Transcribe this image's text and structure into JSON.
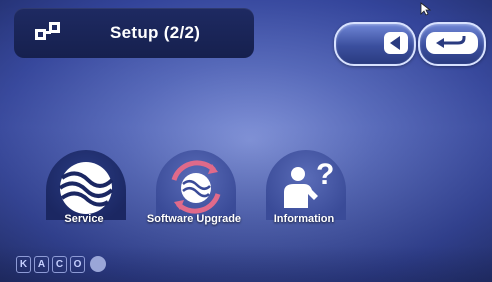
{
  "header": {
    "title": "Setup (2/2)"
  },
  "menu": [
    {
      "label": "Service",
      "icon": "service-icon"
    },
    {
      "label": "Software Upgrade",
      "icon": "software-upgrade-icon"
    },
    {
      "label": "Information",
      "icon": "information-icon"
    }
  ],
  "brand": {
    "letters": [
      "K",
      "A",
      "C",
      "O"
    ]
  },
  "colors": {
    "background": "#4a5cb0",
    "header": "#1a2458",
    "button_border": "#d8e2ff",
    "upgrade_accent": "#e06a8a"
  }
}
